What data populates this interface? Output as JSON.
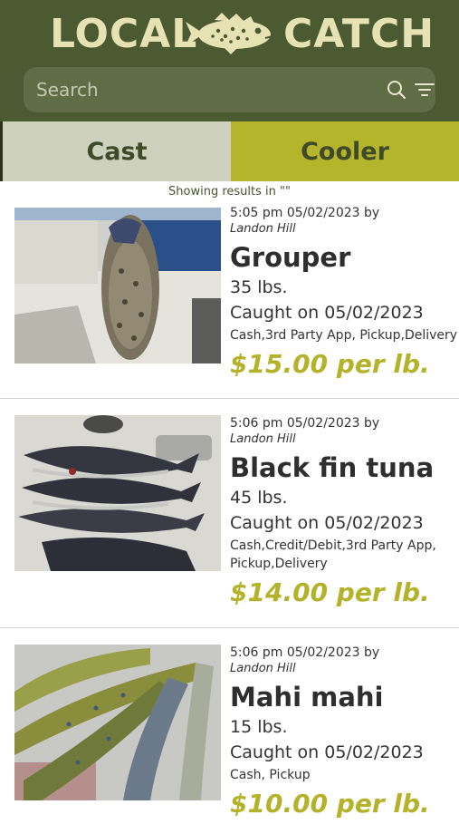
{
  "app": {
    "logo_left": "LOCAL",
    "logo_right": "CATCH",
    "brand_colors": {
      "header": "#4c5a31",
      "accent": "#b5b52c",
      "cream": "#e7e2b4"
    }
  },
  "search": {
    "placeholder": "Search",
    "value": "",
    "search_icon": "search-icon",
    "filter_icon": "filter-icon"
  },
  "tabs": [
    {
      "label": "Cast",
      "selected": false
    },
    {
      "label": "Cooler",
      "selected": true
    }
  ],
  "results_note": "Showing results in \"\"",
  "listings": [
    {
      "posted": "5:05 pm 05/02/2023 by",
      "seller": "Landon Hill",
      "name": "Grouper",
      "weight": "35 lbs.",
      "caught": "Caught on 05/02/2023",
      "payment": "Cash,3rd Party App, Pickup,Delivery",
      "price": "$15.00 per lb."
    },
    {
      "posted": "5:06 pm 05/02/2023 by",
      "seller": "Landon Hill",
      "name": "Black fin tuna",
      "weight": "45 lbs.",
      "caught": "Caught on 05/02/2023",
      "payment": "Cash,Credit/Debit,3rd Party App, Pickup,Delivery",
      "price": "$14.00 per lb."
    },
    {
      "posted": "5:06 pm 05/02/2023 by",
      "seller": "Landon Hill",
      "name": "Mahi mahi",
      "weight": "15 lbs.",
      "caught": "Caught on 05/02/2023",
      "payment": "Cash, Pickup",
      "price": "$10.00 per lb."
    }
  ]
}
